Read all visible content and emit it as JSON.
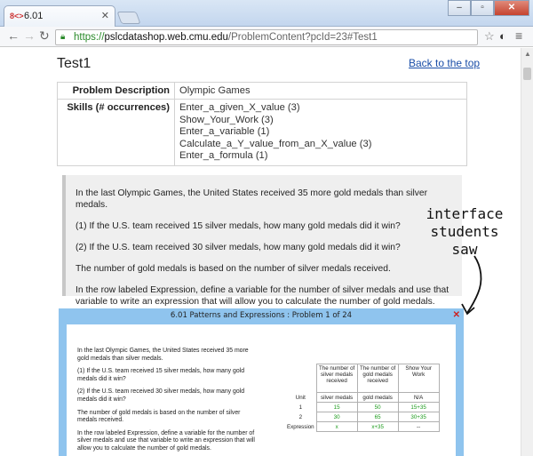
{
  "browser": {
    "tab_title": "6.01",
    "tab_favicon": "8<>",
    "url_scheme": "https://",
    "url_host": "pslcdatashop.web.cmu.edu",
    "url_path": "/ProblemContent?pcId=23#Test1"
  },
  "page": {
    "title": "Test1",
    "back_link": "Back to the top",
    "info": {
      "problem_label": "Problem Description",
      "problem_value": "Olympic Games",
      "skills_label": "Skills (# occurrences)",
      "skills": [
        "Enter_a_given_X_value (3)",
        "Show_Your_Work (3)",
        "Enter_a_variable (1)",
        "Calculate_a_Y_value_from_an_X_value (3)",
        "Enter_a_formula (1)"
      ]
    },
    "problem_text": [
      "In the last Olympic Games, the United States received 35 more gold medals than silver medals.",
      "(1) If the U.S. team received 15 silver medals, how many gold medals did it win?",
      "(2) If the U.S. team received 30 silver medals, how many gold medals did it win?",
      "The number of gold medals is based on the number of silver medals received.",
      "In the row labeled Expression, define a variable for the number of silver medals and use that variable to write an expression that will allow you to calculate the number of gold medals."
    ]
  },
  "annotation": {
    "line1": "interface",
    "line2": "students",
    "line3": "saw"
  },
  "tutor": {
    "title": "6.01 Patterns and Expressions : Problem 1 of 24",
    "close": "✕",
    "text": [
      "In the last Olympic Games, the United States received 35 more gold medals than silver medals.",
      "(1) If the U.S. team received 15 silver medals, how many gold medals did it win?",
      "(2) If the U.S. team received 30 silver medals, how many gold medals did it win?",
      "The number of gold medals is based on the number of silver medals received.",
      "In the row labeled Expression, define a variable for the number of silver medals and use that variable to write an expression that will allow you to calculate the number of gold medals."
    ],
    "table": {
      "headers": [
        "The number of silver medals received",
        "The number of gold medals received",
        "Show Your Work"
      ],
      "unit_label": "Unit",
      "units": [
        "silver medals",
        "gold medals",
        "N/A"
      ],
      "rows": [
        {
          "label": "1",
          "cells": [
            "15",
            "50",
            "15+35"
          ]
        },
        {
          "label": "2",
          "cells": [
            "30",
            "65",
            "30+35"
          ]
        },
        {
          "label": "Expression",
          "cells": [
            "x",
            "x+35",
            "--"
          ]
        }
      ]
    }
  }
}
